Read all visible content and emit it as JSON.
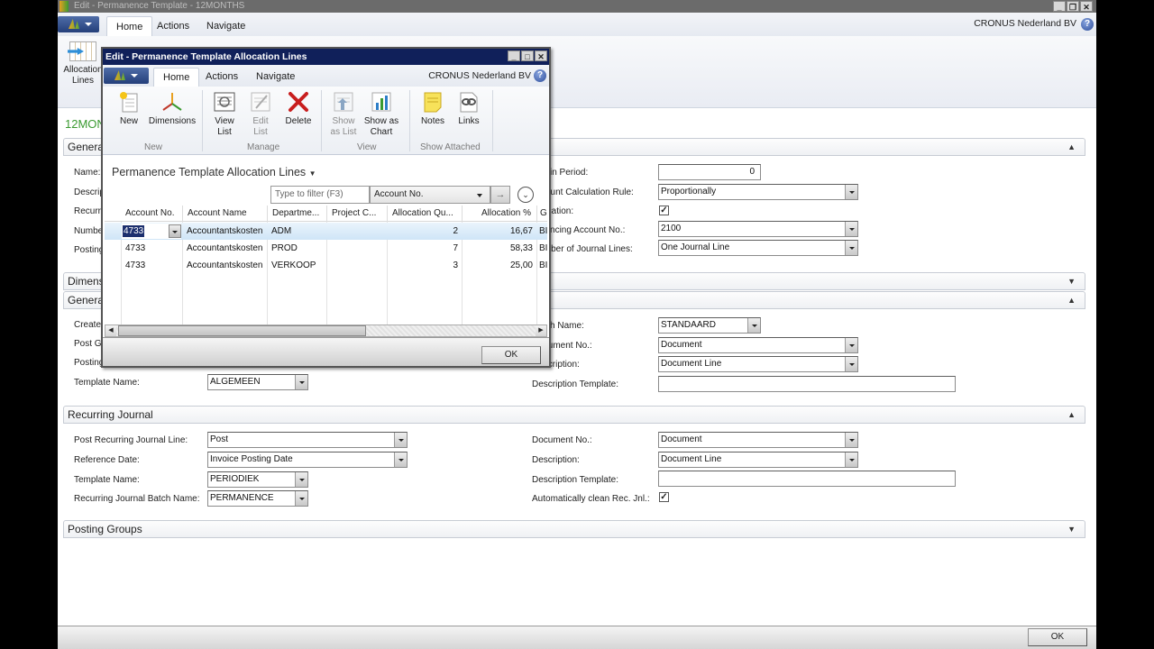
{
  "main_window": {
    "title": "Edit - Permanence Template - 12MONTHS",
    "tabs": [
      {
        "label": "Home",
        "active": true
      },
      {
        "label": "Actions",
        "active": false
      },
      {
        "label": "Navigate",
        "active": false
      }
    ],
    "company": "CRONUS Nederland BV",
    "ribbon": {
      "allocation_lines_label": "Allocation Lines"
    },
    "page_caption": "12MONTHS",
    "sections": {
      "general_1": {
        "title": "General",
        "left_labels": [
          "Name:",
          "Description:",
          "Recurring Method:",
          "Number of Periods:",
          "Posting Date:"
        ],
        "right_fields": [
          {
            "label": "Within Period:",
            "value": "0",
            "type": "number"
          },
          {
            "label": "Amount Calculation Rule:",
            "value": "Proportionally",
            "type": "dropdown"
          },
          {
            "label": "Allocation:",
            "checked": true,
            "type": "checkbox"
          },
          {
            "label": "Balancing Account No.:",
            "value": "2100",
            "type": "dropdown"
          },
          {
            "label": "Number of Journal Lines:",
            "value": "One Journal Line",
            "type": "dropdown"
          }
        ]
      },
      "dimensions": {
        "title": "Dimensions",
        "collapsed": true
      },
      "general_2": {
        "title": "General Journal",
        "left_labels": [
          "Create General Journal:",
          "Post General Journal Line:",
          "Posting Date:"
        ],
        "template_name": {
          "label": "Template Name:",
          "value": "ALGEMEEN"
        },
        "right_fields": [
          {
            "label": "Batch Name:",
            "value": "STANDAARD",
            "type": "dropdown"
          },
          {
            "label": "Document No.:",
            "value": "Document",
            "type": "dropdown"
          },
          {
            "label": "Description:",
            "value": "Document Line",
            "type": "dropdown"
          },
          {
            "label": "Description Template:",
            "value": "",
            "type": "text"
          }
        ]
      },
      "recurring_journal": {
        "title": "Recurring Journal",
        "left_fields": [
          {
            "label": "Post Recurring Journal Line:",
            "value": "Post"
          },
          {
            "label": "Reference Date:",
            "value": "Invoice Posting Date"
          },
          {
            "label": "Template Name:",
            "value": "PERIODIEK"
          },
          {
            "label": "Recurring Journal Batch Name:",
            "value": "PERMANENCE"
          }
        ],
        "right_fields": [
          {
            "label": "Document No.:",
            "value": "Document",
            "type": "dropdown"
          },
          {
            "label": "Description:",
            "value": "Document Line",
            "type": "dropdown"
          },
          {
            "label": "Description Template:",
            "value": "",
            "type": "text"
          },
          {
            "label": "Automatically clean Rec. Jnl.:",
            "checked": true,
            "type": "checkbox"
          }
        ]
      },
      "posting_groups": {
        "title": "Posting Groups",
        "collapsed": true
      }
    },
    "ok_label": "OK"
  },
  "dialog": {
    "title": "Edit - Permanence Template Allocation Lines",
    "tabs": [
      {
        "label": "Home",
        "active": true
      },
      {
        "label": "Actions",
        "active": false
      },
      {
        "label": "Navigate",
        "active": false
      }
    ],
    "company": "CRONUS Nederland BV",
    "ribbon": {
      "groups": [
        {
          "label": "New",
          "buttons": [
            {
              "label": "New",
              "icon": "new-document-icon"
            },
            {
              "label": "Dimensions",
              "icon": "dimensions-icon"
            }
          ]
        },
        {
          "label": "Manage",
          "buttons": [
            {
              "label": "View List",
              "icon": "view-list-icon"
            },
            {
              "label": "Edit List",
              "icon": "edit-list-icon",
              "disabled": true
            },
            {
              "label": "Delete",
              "icon": "delete-icon"
            }
          ]
        },
        {
          "label": "View",
          "buttons": [
            {
              "label": "Show as List",
              "icon": "show-as-list-icon",
              "disabled": true
            },
            {
              "label": "Show as Chart",
              "icon": "show-as-chart-icon"
            }
          ]
        },
        {
          "label": "Show Attached",
          "buttons": [
            {
              "label": "Notes",
              "icon": "notes-icon"
            },
            {
              "label": "Links",
              "icon": "links-icon"
            }
          ]
        }
      ]
    },
    "caption": "Permanence Template Allocation Lines",
    "filter": {
      "placeholder": "Type to filter (F3)",
      "field": "Account No."
    },
    "columns": [
      "Account No.",
      "Account Name",
      "Departme...",
      "Project C...",
      "Allocation Qu...",
      "Allocation %",
      "Ge"
    ],
    "rows": [
      {
        "account_no": "4733",
        "account_name": "Accountantskosten",
        "department": "ADM",
        "project": "",
        "alloc_qty": "2",
        "alloc_pct": "16,67",
        "ge": "BI",
        "selected": true
      },
      {
        "account_no": "4733",
        "account_name": "Accountantskosten",
        "department": "PROD",
        "project": "",
        "alloc_qty": "7",
        "alloc_pct": "58,33",
        "ge": "BI",
        "selected": false
      },
      {
        "account_no": "4733",
        "account_name": "Accountantskosten",
        "department": "VERKOOP",
        "project": "",
        "alloc_qty": "3",
        "alloc_pct": "25,00",
        "ge": "BI",
        "selected": false
      }
    ],
    "ok_label": "OK"
  }
}
